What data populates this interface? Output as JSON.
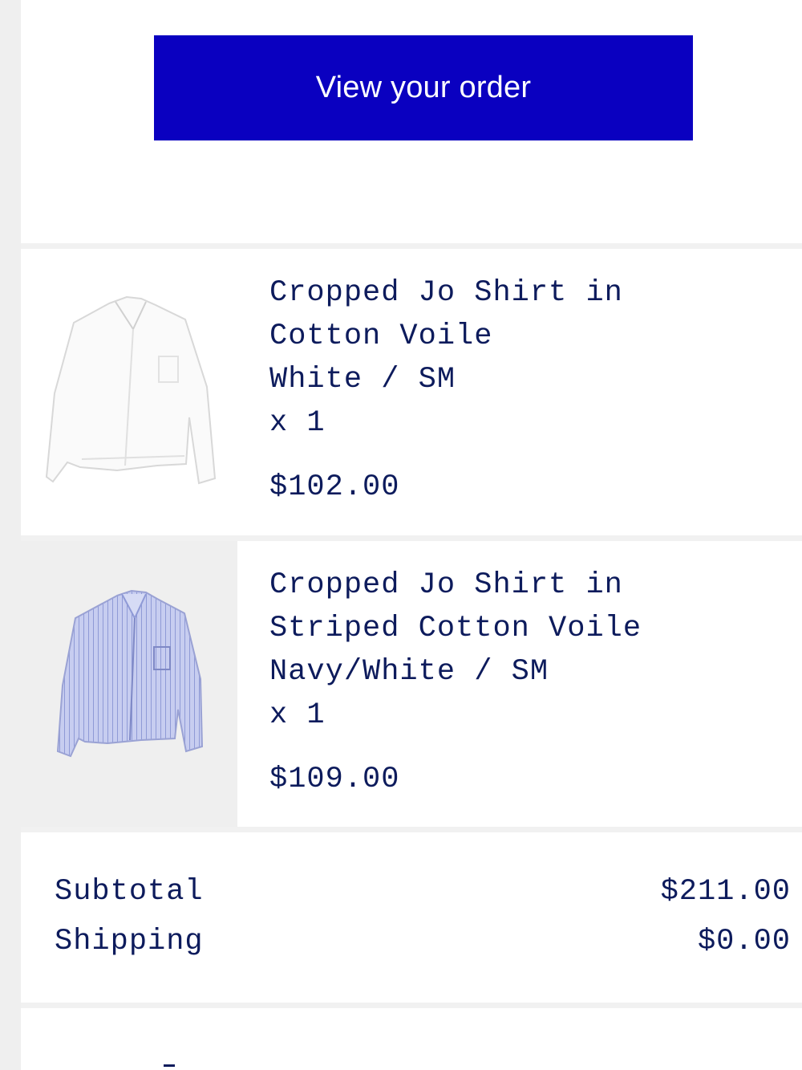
{
  "cta": {
    "label": "View your order",
    "color": "#0a00c0"
  },
  "items": [
    {
      "title": "Cropped Jo Shirt in\nCotton Voile",
      "variant": "White / SM",
      "quantity": "x 1",
      "price": "$102.00",
      "image_icon": "white-shirt-image"
    },
    {
      "title": "Cropped Jo Shirt in\nStriped Cotton Voile",
      "variant": "Navy/White / SM",
      "quantity": "x 1",
      "price": "$109.00",
      "image_icon": "striped-shirt-image"
    }
  ],
  "totals": {
    "subtotal_label": "Subtotal",
    "subtotal_value": "$211.00",
    "shipping_label": "Shipping",
    "shipping_value": "$0.00"
  },
  "colors": {
    "text": "#0d1b5c",
    "divider": "#f1f1f1",
    "rail": "#efefef"
  }
}
